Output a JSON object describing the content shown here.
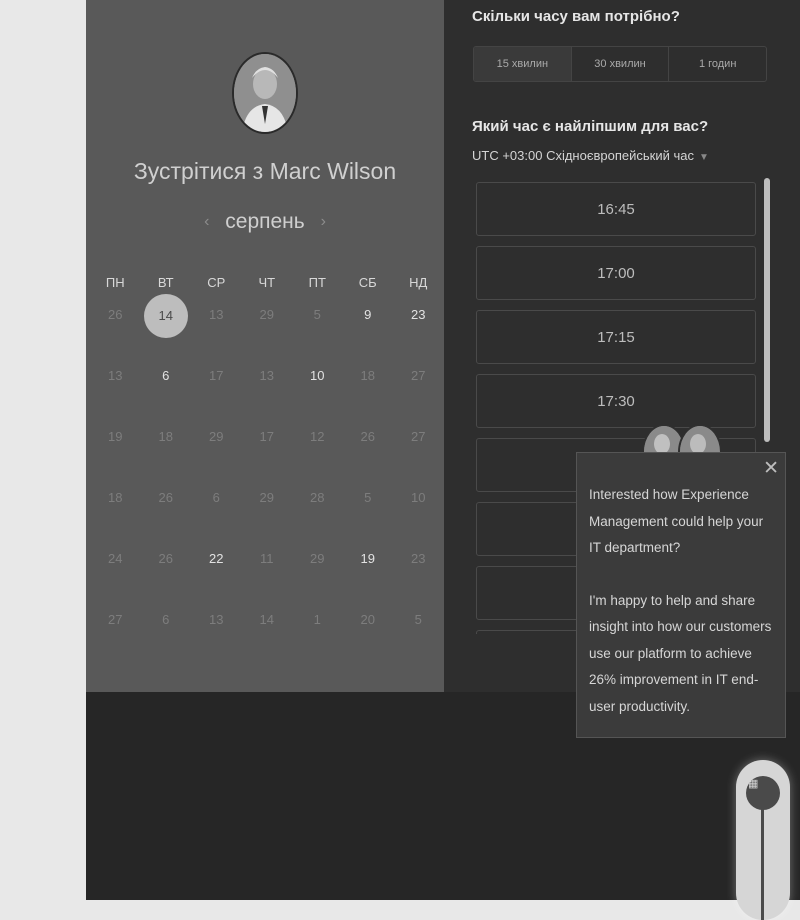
{
  "host": {
    "title": "Зустрітися з Marc Wilson"
  },
  "calendar": {
    "month": "серпень",
    "prev": "‹",
    "next": "›",
    "weekdays": [
      "ПН",
      "ВТ",
      "СР",
      "ЧТ",
      "ПТ",
      "СБ",
      "НД"
    ],
    "weeks": [
      [
        "26",
        "14",
        "13",
        "29",
        "5",
        "9",
        "23"
      ],
      [
        "13",
        "6",
        "17",
        "13",
        "10",
        "18",
        "27"
      ],
      [
        "19",
        "18",
        "29",
        "17",
        "12",
        "26",
        "27"
      ],
      [
        "18",
        "26",
        "6",
        "29",
        "28",
        "5",
        "10"
      ],
      [
        "24",
        "26",
        "22",
        "11",
        "29",
        "19",
        "23"
      ],
      [
        "27",
        "6",
        "13",
        "14",
        "1",
        "20",
        "5"
      ]
    ],
    "available": [
      [
        0,
        1
      ],
      [
        0,
        5
      ],
      [
        0,
        6
      ],
      [
        1,
        1
      ],
      [
        1,
        4
      ],
      [
        4,
        2
      ],
      [
        4,
        5
      ]
    ],
    "selected": [
      0,
      1
    ]
  },
  "duration": {
    "question": "Скільки часу вам потрібно?",
    "options": [
      "15 хвилин",
      "30 хвилин",
      "1 годин"
    ],
    "active_index": 0
  },
  "time": {
    "question": "Який час є найліпшим для вас?",
    "timezone": "UTC +03:00 Східноєвропейський час",
    "slots": [
      "16:45",
      "17:00",
      "17:15",
      "17:30",
      "",
      "",
      "",
      ""
    ]
  },
  "popup": {
    "message1": "Interested how Experience Management could help your IT department?",
    "message2": "I'm happy to help and share insight into how our customers use our platform to achieve 26% improvement in IT end-user productivity.",
    "close": "✕"
  },
  "icons": {
    "launcher": "chat-launcher-icon",
    "close": "close-icon"
  }
}
